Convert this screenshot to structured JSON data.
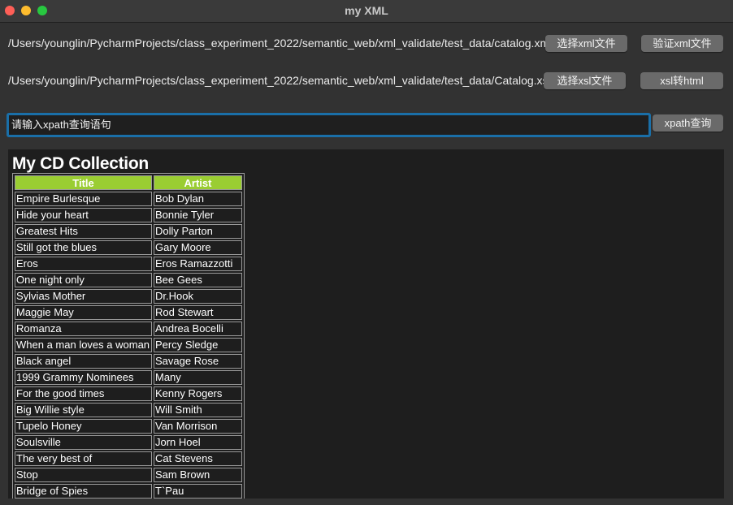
{
  "window": {
    "title": "my XML"
  },
  "files": {
    "xml_path": "/Users/younglin/PycharmProjects/class_experiment_2022/semantic_web/xml_validate/test_data/catalog.xml",
    "xsl_path": "/Users/younglin/PycharmProjects/class_experiment_2022/semantic_web/xml_validate/test_data/Catalog.xsl"
  },
  "buttons": {
    "select_xml": "选择xml文件",
    "validate_xml": "验证xml文件",
    "select_xsl": "选择xsl文件",
    "xsl_to_html": "xsl转html",
    "xpath_query": "xpath查询"
  },
  "xpath": {
    "value": "请输入xpath查询语句"
  },
  "result": {
    "heading": "My CD Collection",
    "columns": [
      "Title",
      "Artist"
    ],
    "header_color": "#9acd32",
    "rows": [
      {
        "title": "Empire Burlesque",
        "artist": "Bob Dylan"
      },
      {
        "title": "Hide your heart",
        "artist": "Bonnie Tyler"
      },
      {
        "title": "Greatest Hits",
        "artist": "Dolly Parton"
      },
      {
        "title": "Still got the blues",
        "artist": "Gary Moore"
      },
      {
        "title": "Eros",
        "artist": "Eros Ramazzotti"
      },
      {
        "title": "One night only",
        "artist": "Bee Gees"
      },
      {
        "title": "Sylvias Mother",
        "artist": "Dr.Hook"
      },
      {
        "title": "Maggie May",
        "artist": "Rod Stewart"
      },
      {
        "title": "Romanza",
        "artist": "Andrea Bocelli"
      },
      {
        "title": "When a man loves a woman",
        "artist": "Percy Sledge"
      },
      {
        "title": "Black angel",
        "artist": "Savage Rose"
      },
      {
        "title": "1999 Grammy Nominees",
        "artist": "Many"
      },
      {
        "title": "For the good times",
        "artist": "Kenny Rogers"
      },
      {
        "title": "Big Willie style",
        "artist": "Will Smith"
      },
      {
        "title": "Tupelo Honey",
        "artist": "Van Morrison"
      },
      {
        "title": "Soulsville",
        "artist": "Jorn Hoel"
      },
      {
        "title": "The very best of",
        "artist": "Cat Stevens"
      },
      {
        "title": "Stop",
        "artist": "Sam Brown"
      },
      {
        "title": "Bridge of Spies",
        "artist": "T`Pau"
      }
    ]
  }
}
